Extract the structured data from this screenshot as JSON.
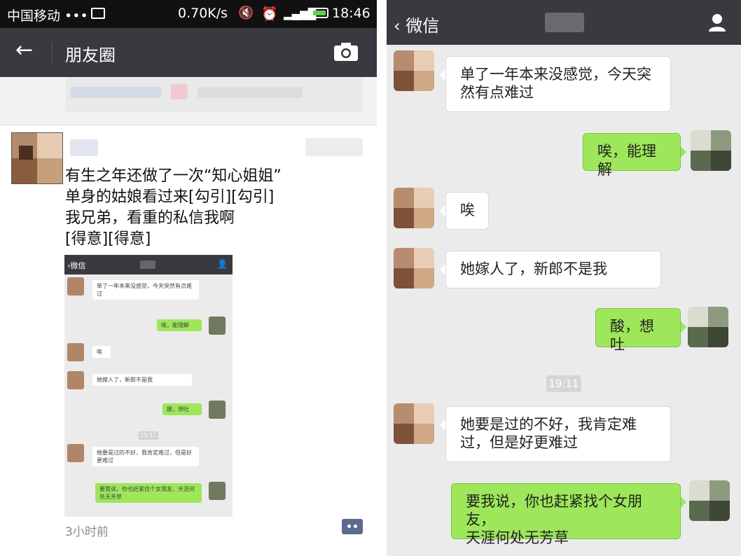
{
  "status_bar": {
    "carrier": "中国移动 •••",
    "speed": "0.70K/s",
    "time": "18:46"
  },
  "moments": {
    "title": "朋友圈",
    "back_icon": "arrow-left-icon",
    "camera_icon": "camera-icon",
    "post": {
      "lines": [
        "有生之年还做了一次“知心姐姐”",
        "单身的姑娘看过来[勾引][勾引]",
        "我兄弟，看重的私信我啊",
        "[得意][得意]"
      ],
      "time": "3小时前"
    }
  },
  "thumbnail": {
    "back_label": "微信",
    "messages": [
      "单了一年本来没感觉，今天突然有点难过",
      "唉，能理解",
      "唉",
      "她嫁人了，新郎不是我",
      "酸，想吐",
      "19:11",
      "她要是过的不好，我肯定难过，但是好更难过",
      "要我说，你也赶紧找个女朋友，天涯何处无芳草"
    ]
  },
  "chat": {
    "back_label": "微信",
    "time_divider": "19:11",
    "messages": [
      {
        "side": "left",
        "lines": [
          "单了一年本来没感觉，今天突",
          "然有点难过"
        ]
      },
      {
        "side": "right",
        "lines": [
          "唉，能理解"
        ]
      },
      {
        "side": "left",
        "lines": [
          "唉"
        ]
      },
      {
        "side": "left",
        "lines": [
          "她嫁人了，新郎不是我"
        ]
      },
      {
        "side": "right",
        "lines": [
          "酸，想吐"
        ]
      },
      {
        "side": "left",
        "lines": [
          "她要是过的不好，我肯定难",
          "过，但是好更难过"
        ]
      },
      {
        "side": "right",
        "lines": [
          "要我说，你也赶紧找个女朋友，",
          "天涯何处无芳草"
        ]
      }
    ]
  },
  "colors": {
    "nav_bg": "#393a3f",
    "bubble_green": "#9ee65a",
    "chat_bg": "#ebebeb"
  }
}
